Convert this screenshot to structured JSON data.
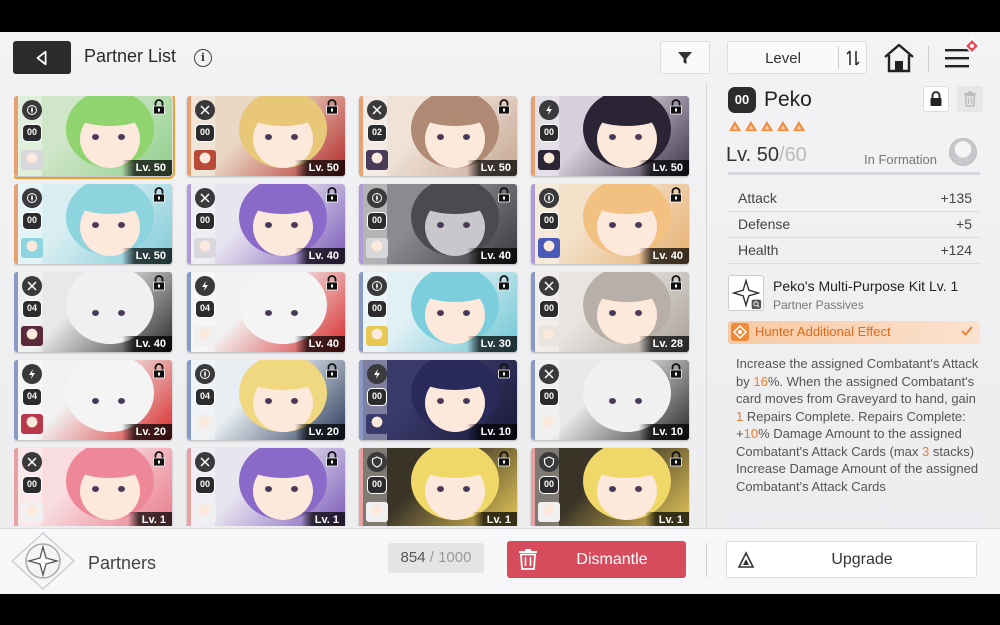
{
  "header": {
    "title": "Partner List",
    "info_label": "i",
    "sort_label": "Level"
  },
  "partners": [
    {
      "rank": "00",
      "level": "Lv. 50",
      "type": "compass",
      "stripe": "#e8a070",
      "art": [
        "#cfe6c8",
        "#8fce8a"
      ],
      "hair": "#8fd46e",
      "skin": "#fde8dc",
      "avatar": "#d8d8dc",
      "selected": true
    },
    {
      "rank": "00",
      "level": "Lv. 50",
      "type": "swords",
      "stripe": "#e8a070",
      "art": [
        "#ead8c4",
        "#b32a2a"
      ],
      "hair": "#e8c878",
      "skin": "#fde8dc",
      "avatar": "#b84a3a"
    },
    {
      "rank": "02",
      "level": "Lv. 50",
      "type": "swords",
      "stripe": "#e8a070",
      "art": [
        "#efe2d6",
        "#c7a794"
      ],
      "hair": "#b08a74",
      "skin": "#fde8dc",
      "avatar": "#4a3a5a"
    },
    {
      "rank": "00",
      "level": "Lv. 50",
      "type": "bolt",
      "stripe": "#e8a070",
      "art": [
        "#d8d0dc",
        "#3a3248"
      ],
      "hair": "#2a2434",
      "skin": "#fde8dc",
      "avatar": "#2a2434"
    },
    {
      "rank": "00",
      "level": "Lv. 50",
      "type": "compass",
      "stripe": "#e8a070",
      "art": [
        "#d8eef2",
        "#7ecad6"
      ],
      "hair": "#8ed4de",
      "skin": "#fde8dc",
      "avatar": "#8ed4de"
    },
    {
      "rank": "00",
      "level": "Lv. 40",
      "type": "swords",
      "stripe": "#b09ad8",
      "art": [
        "#e8e4f0",
        "#7a5ab8"
      ],
      "hair": "#8a6ac8",
      "skin": "#fde8dc",
      "avatar": "#d8d8dc"
    },
    {
      "rank": "00",
      "level": "Lv. 40",
      "type": "compass",
      "stripe": "#b09ad8",
      "art": [
        "#8c8a90",
        "#3a3a3e"
      ],
      "hair": "#4a4a50",
      "skin": "#c8c8cc",
      "avatar": "#d8d8dc"
    },
    {
      "rank": "00",
      "level": "Lv. 40",
      "type": "compass",
      "stripe": "#b09ad8",
      "art": [
        "#f2e0c8",
        "#e8b070"
      ],
      "hair": "#f2c080",
      "skin": "#fde8dc",
      "avatar": "#4a5ab8"
    },
    {
      "rank": "04",
      "level": "Lv. 40",
      "type": "swords",
      "stripe": "#8a9ac8",
      "art": [
        "#e8e8e8",
        "#2a2a2c"
      ],
      "hair": "#f0f0f0",
      "skin": "#f0f0f0",
      "avatar": "#5a2a3a"
    },
    {
      "rank": "04",
      "level": "Lv. 40",
      "type": "bolt",
      "stripe": "#8a9ac8",
      "art": [
        "#f2f2f2",
        "#d82a2a"
      ],
      "hair": "#f4f4f4",
      "skin": "#f4f4f4",
      "avatar": "#f0f0f0"
    },
    {
      "rank": "00",
      "level": "Lv. 30",
      "type": "compass",
      "stripe": "#8a9ac8",
      "art": [
        "#e0f0f4",
        "#6ec6d4"
      ],
      "hair": "#7ccedc",
      "skin": "#fde8dc",
      "avatar": "#e8c850"
    },
    {
      "rank": "00",
      "level": "Lv. 28",
      "type": "swords",
      "stripe": "#8a9ac8",
      "art": [
        "#e8e4e0",
        "#a8a098"
      ],
      "hair": "#b8b0a8",
      "skin": "#fde8dc",
      "avatar": "#e8e4e0"
    },
    {
      "rank": "04",
      "level": "Lv. 20",
      "type": "bolt",
      "stripe": "#8a9ac8",
      "art": [
        "#f2f2f2",
        "#d82a2a"
      ],
      "hair": "#f4f4f4",
      "skin": "#f4f4f4",
      "avatar": "#b83a4a"
    },
    {
      "rank": "04",
      "level": "Lv. 20",
      "type": "compass",
      "stripe": "#8a9ac8",
      "art": [
        "#e8eef2",
        "#2a3a5a"
      ],
      "hair": "#f0d880",
      "skin": "#fde8dc",
      "avatar": "#f0f0f0"
    },
    {
      "rank": "00",
      "level": "Lv. 10",
      "type": "bolt",
      "stripe": "#8a9ac8",
      "art": [
        "#3a3a6a",
        "#1a1a3a"
      ],
      "hair": "#2a2a5a",
      "skin": "#fde8dc",
      "avatar": "#3a3a6a"
    },
    {
      "rank": "00",
      "level": "Lv. 10",
      "type": "swords",
      "stripe": "#8a9ac8",
      "art": [
        "#e8e8e8",
        "#2a2a2c"
      ],
      "hair": "#f0f0f0",
      "skin": "#f0f0f0",
      "avatar": "#f0f0f0"
    },
    {
      "rank": "00",
      "level": "Lv. 1",
      "type": "swords",
      "stripe": "#e8a0a0",
      "art": [
        "#f8dce0",
        "#e87a8a"
      ],
      "hair": "#ee8898",
      "skin": "#fde8dc",
      "avatar": "#f0f0f0"
    },
    {
      "rank": "00",
      "level": "Lv. 1",
      "type": "swords",
      "stripe": "#e8a0a0",
      "art": [
        "#e8e4f0",
        "#7a5ab8"
      ],
      "hair": "#8a6ac8",
      "skin": "#fde8dc",
      "avatar": "#f0f0f0"
    },
    {
      "rank": "00",
      "level": "Lv. 1",
      "type": "shield",
      "stripe": "#e8a0a0",
      "art": [
        "#3a3428",
        "#e8c858"
      ],
      "hair": "#f0d868",
      "skin": "#fde8dc",
      "avatar": "#f0f0f0"
    },
    {
      "rank": "00",
      "level": "Lv. 1",
      "type": "shield",
      "stripe": "#e8a0a0",
      "art": [
        "#3a3428",
        "#e8c858"
      ],
      "hair": "#f0d868",
      "skin": "#fde8dc",
      "avatar": "#f0f0f0"
    }
  ],
  "detail": {
    "rank": "00",
    "name": "Peko",
    "stars": 5,
    "level_prefix": "Lv. 50",
    "level_sep": "/",
    "level_max": "60",
    "formation_label": "In Formation",
    "stats": [
      {
        "name": "Attack",
        "value": "+135"
      },
      {
        "name": "Defense",
        "value": "+5"
      },
      {
        "name": "Health",
        "value": "+124"
      }
    ],
    "passive_name": "Peko's Multi-Purpose Kit Lv. 1",
    "passive_sub": "Partner Passives",
    "hunter_label": "Hunter Additional Effect",
    "desc": {
      "p1": "Increase the assigned Combatant's Attack by ",
      "v1": "16",
      "p2": "%. When the assigned Combatant's card moves from Graveyard to hand, gain ",
      "v2": "1",
      "p3": " Repairs Complete. Repairs Complete: +",
      "v3": "10",
      "p4": "% Damage Amount to the assigned Combatant's Attack Cards (max ",
      "v4": "3",
      "p5": " stacks) Increase Damage Amount of the assigned Combatant's Attack Cards"
    }
  },
  "footer": {
    "partners_label": "Partners",
    "count": "854",
    "count_sep": " / ",
    "count_max": "1000",
    "dismantle_label": "Dismantle",
    "upgrade_label": "Upgrade"
  },
  "colors": {
    "accent_orange": "#f07a2a",
    "dismantle_red": "#d74c5c",
    "selected_outline": "#f0a030"
  }
}
